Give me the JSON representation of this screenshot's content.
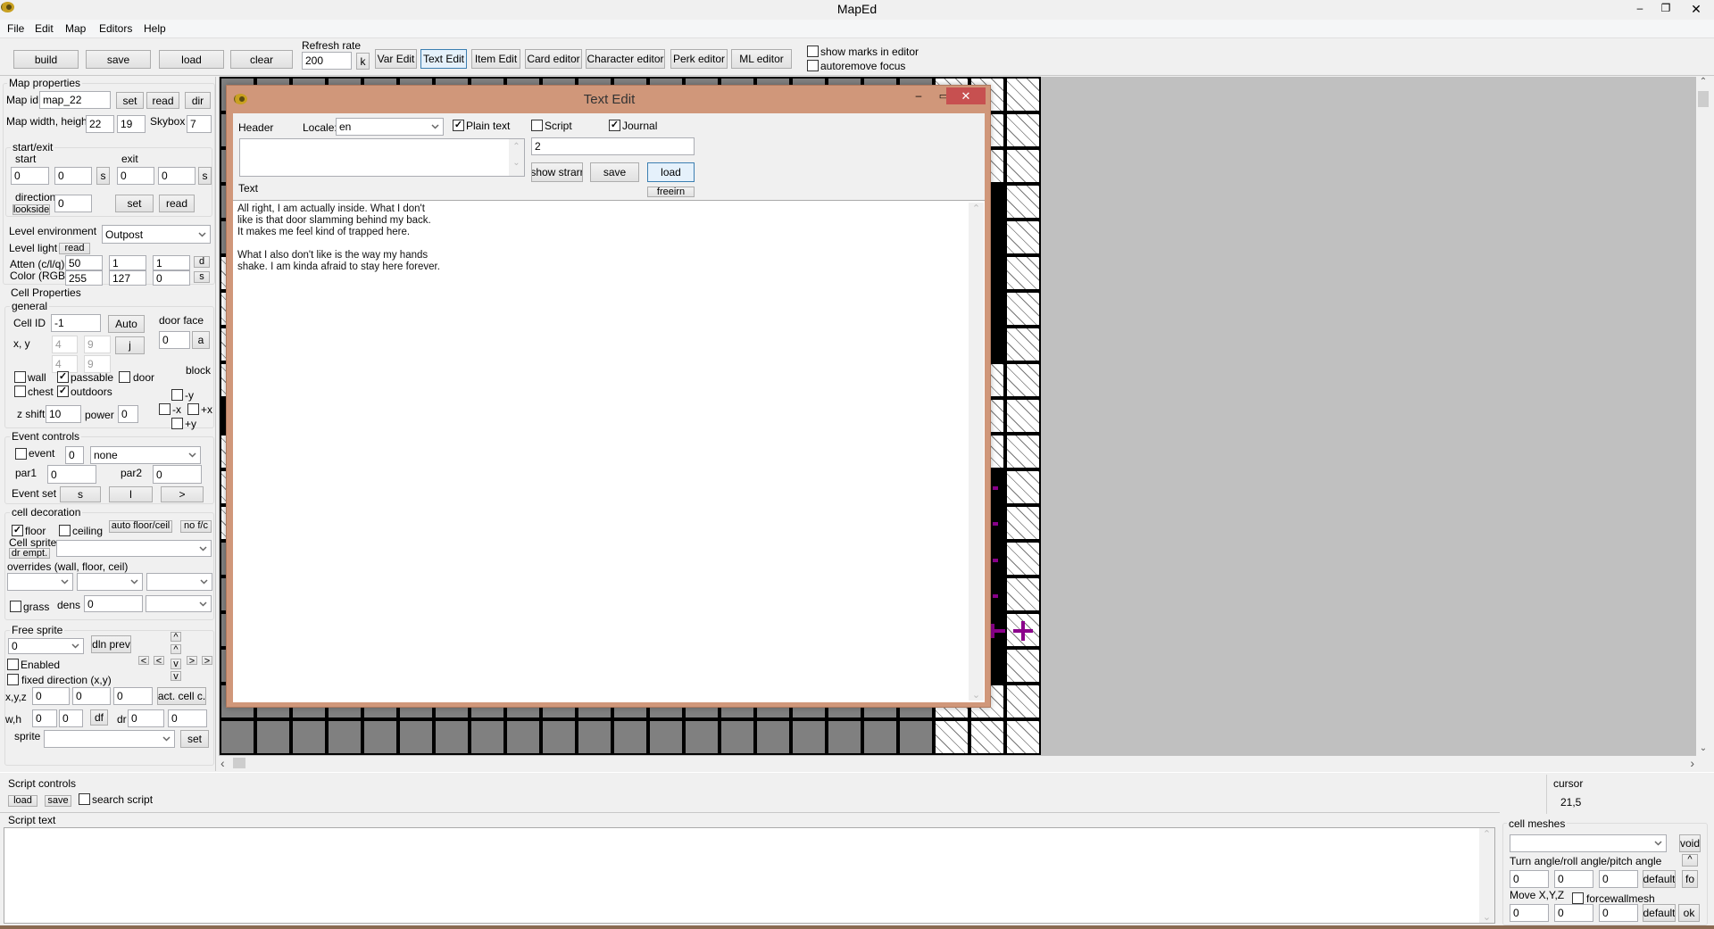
{
  "window": {
    "title": "MapEd",
    "menu": [
      "File",
      "Edit",
      "Map",
      "Editors",
      "Help"
    ]
  },
  "toolbar": {
    "build": "build",
    "save": "save",
    "load": "load",
    "clear": "clear",
    "refresh_rate_label": "Refresh rate",
    "refresh_rate": "200",
    "k": "k",
    "var_edit": "Var Edit",
    "text_edit": "Text Edit",
    "item_edit": "Item Edit",
    "card_editor": "Card editor",
    "character_editor": "Character editor",
    "perk_editor": "Perk editor",
    "ml_editor": "ML editor",
    "show_marks": {
      "label": "show marks in editor",
      "checked": false
    },
    "autoremove_focus": {
      "label": "autoremove focus",
      "checked": false
    }
  },
  "map_properties": {
    "title": "Map properties",
    "map_id_label": "Map id",
    "map_id": "map_22",
    "set": "set",
    "read": "read",
    "dir": "dir",
    "size_label": "Map width, height",
    "width": "22",
    "height": "19",
    "skybox_label": "Skybox",
    "skybox": "7",
    "start_exit": {
      "title": "start/exit",
      "start_label": "start",
      "exit_label": "exit",
      "start_x": "0",
      "start_y": "0",
      "exit_x": "0",
      "exit_y": "0",
      "s": "s",
      "direction_label": "direction",
      "lookside": "lookside",
      "direction": "0",
      "set": "set",
      "read": "read"
    },
    "env_label": "Level environment",
    "environment": "Outpost",
    "light_label": "Level light",
    "light_read": "read",
    "atten_label": "Atten (c/l/q)",
    "atten": [
      "50",
      "1",
      "1"
    ],
    "d": "d",
    "color_label": "Color (RGB)",
    "color": [
      "255",
      "127",
      "0"
    ],
    "s": "s"
  },
  "cell_properties": {
    "title": "Cell Properties",
    "general": "general",
    "cell_id_label": "Cell ID",
    "cell_id": "-1",
    "auto": "Auto",
    "door_face_label": "door face",
    "door_face": "0",
    "a": "a",
    "xy_label": "x, y",
    "xy": [
      "4",
      "9"
    ],
    "xy2": [
      "4",
      "9"
    ],
    "j": "j",
    "block_label": "block",
    "wall": {
      "label": "wall",
      "checked": false
    },
    "passable": {
      "label": "passable",
      "checked": true
    },
    "door": {
      "label": "door",
      "checked": false
    },
    "chest": {
      "label": "chest",
      "checked": false
    },
    "outdoors": {
      "label": "outdoors",
      "checked": true
    },
    "block_ny": {
      "label": "-y",
      "checked": false
    },
    "block_nx": {
      "label": "-x",
      "checked": false
    },
    "block_px": {
      "label": "+x",
      "checked": false
    },
    "block_py": {
      "label": "+y",
      "checked": false
    },
    "z_shift_label": "z shift",
    "z_shift": "10",
    "power_label": "power",
    "power": "0"
  },
  "event_controls": {
    "title": "Event controls",
    "event": {
      "label": "event",
      "checked": false
    },
    "event_id": "0",
    "event_type": "none",
    "par1_label": "par1",
    "par1": "0",
    "par2_label": "par2",
    "par2": "0",
    "event_set_label": "Event set",
    "s": "s",
    "l": "l",
    "next": ">"
  },
  "cell_decoration": {
    "title": "cell decoration",
    "floor": {
      "label": "floor",
      "checked": true
    },
    "ceiling": {
      "label": "ceiling",
      "checked": false
    },
    "auto_floor_ceil": "auto floor/ceil",
    "no_fc": "no f/c",
    "cell_sprite_label": "Cell sprite",
    "dr_empt": "dr empt.",
    "cell_sprite": "",
    "overrides_label": "overrides (wall, floor, ceil)",
    "grass": {
      "label": "grass",
      "checked": false
    },
    "dens_label": "dens",
    "dens": "0"
  },
  "free_sprite": {
    "title": "Free sprite",
    "sprite_index": "0",
    "dln_prev": "dln prev",
    "up": "^",
    "left": "<",
    "down": "v",
    "right": ">",
    "enabled": {
      "label": "Enabled",
      "checked": false
    },
    "fixed_direction": {
      "label": "fixed direction (x,y)",
      "checked": false
    },
    "xyz_label": "x,y,z",
    "xyz": [
      "0",
      "0",
      "0"
    ],
    "act_cell": "act. cell c.",
    "wh_label": "w,h",
    "wh": [
      "0",
      "0"
    ],
    "df": "df",
    "dr_label": "dr",
    "dr": [
      "0",
      "0"
    ],
    "sprite_label": "sprite",
    "set": "set"
  },
  "script": {
    "controls_title": "Script controls",
    "load": "load",
    "save": "save",
    "search": {
      "label": "search script",
      "checked": false
    },
    "text_title": "Script text",
    "text": ""
  },
  "cursor": {
    "label": "cursor",
    "value": "21,5"
  },
  "cell_meshes": {
    "title": "cell meshes",
    "void": "void",
    "angle_label": "Turn angle/roll angle/pitch angle",
    "up": "^",
    "angles": [
      "0",
      "0",
      "0"
    ],
    "default": "default",
    "fo": "fo",
    "move_label": "Move X,Y,Z",
    "forcewallmesh": {
      "label": "forcewallmesh",
      "checked": false
    },
    "move": [
      "0",
      "0",
      "0"
    ],
    "ok": "ok"
  },
  "text_edit": {
    "title": "Text Edit",
    "header_label": "Header",
    "locale_label": "Locale:",
    "locale": "en",
    "plain_text": {
      "label": "Plain text",
      "checked": true
    },
    "script": {
      "label": "Script",
      "checked": false
    },
    "journal": {
      "label": "Journal",
      "checked": true
    },
    "header": "",
    "id": "2",
    "show_strarr": "show strarr",
    "save": "save",
    "load": "load",
    "freeirn": "freeirn",
    "text_label": "Text",
    "text_lines": [
      "All right, I am actually inside. What I don't",
      "like is that door slamming behind my back.",
      "It makes me feel kind of trapped here.",
      "",
      "What I also don't like is the way my hands",
      "shake. I am kinda afraid to stay here forever."
    ]
  },
  "map": {
    "rows": [
      "gggggggggggggggggggghhh",
      "gggggggggggggggggggghhh",
      "gggggggggggggggggggghhh",
      "gggggggggggggggggggghbh",
      "gggggggggggggggggggghbh",
      "hggggggggggggggggggghbh",
      "hggggggggggggggggggghbh",
      "hggggggggggggggggggghbh",
      "hggggggggggggggggggghhh",
      "bggggggggggggggggggghhh",
      "hggggggggggggggggggghhh",
      "hggggggggggggggggggghbh",
      "hggggggggggggggggggghbh",
      "gggggggggggggggggggghbh",
      "gggggggggggggggggggghbh",
      "gggggggggggggggggggghbh",
      "gggggggggggggggggggghbh",
      "gggggggggggggggggggghhh",
      "gggggggggggggggggggghhh"
    ]
  },
  "colors": {
    "dialog_frame": "#d0977a",
    "close": "#c75050",
    "marker": "#8b008b"
  }
}
